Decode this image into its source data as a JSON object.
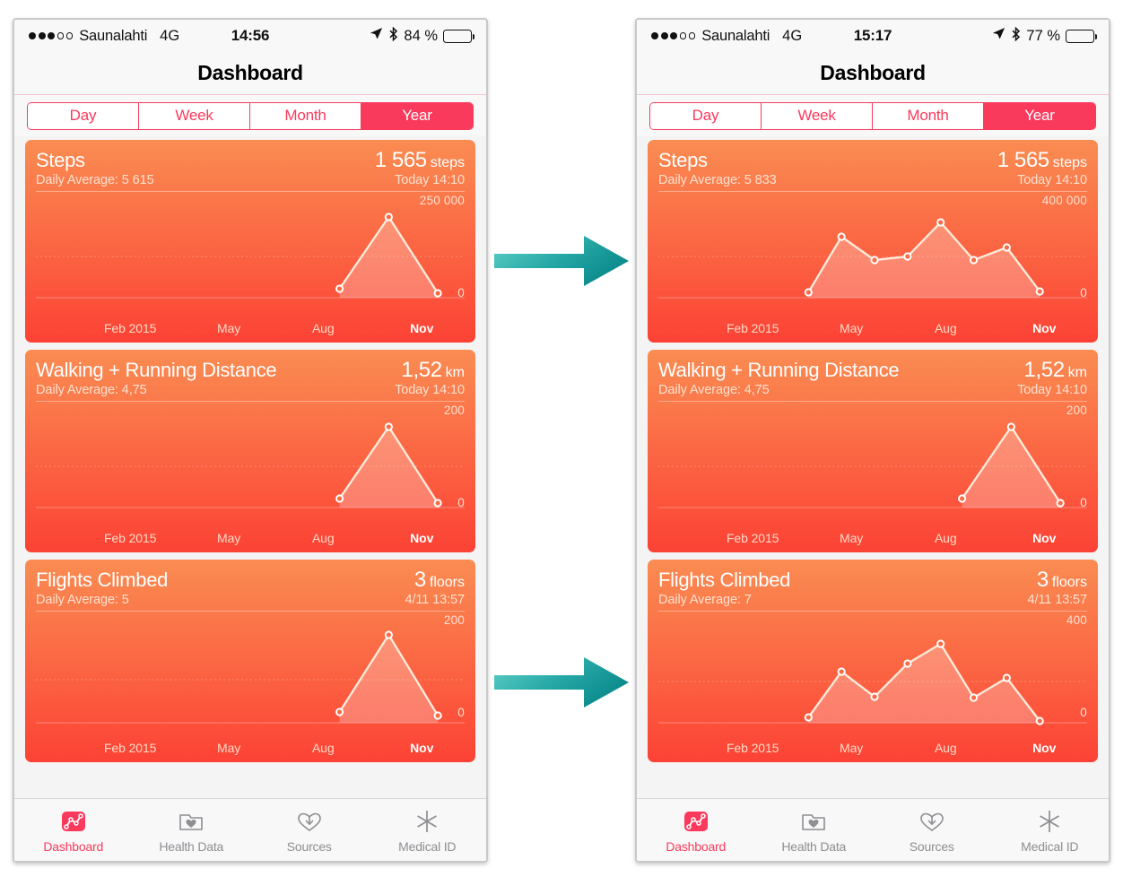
{
  "accent": {
    "pink": "#fa3a5c",
    "card_top": "#fa8c52",
    "card_bottom": "#fc4235",
    "arrow_teal_light": "#5fd0c8",
    "arrow_teal_dark": "#0e8f8f",
    "tab_inactive": "#8e8e93"
  },
  "left_phone": {
    "status": {
      "carrier": "Saunalahti",
      "network": "4G",
      "time": "14:56",
      "battery_percent": "84 %",
      "signal_dots_filled": 3,
      "signal_dots_total": 5,
      "location_icon": "location-arrow-icon",
      "bluetooth_icon": "bluetooth-icon"
    },
    "nav": {
      "title": "Dashboard"
    },
    "segmented": {
      "options": [
        "Day",
        "Week",
        "Month",
        "Year"
      ],
      "selected": "Year"
    },
    "cards": [
      {
        "title": "Steps",
        "value": "1 565",
        "unit": "steps",
        "average": "Daily Average: 5 615",
        "when": "Today 14:10",
        "y_max": "250 000",
        "y_min": "0"
      },
      {
        "title": "Walking + Running Distance",
        "value": "1,52",
        "unit": "km",
        "average": "Daily Average: 4,75",
        "when": "Today 14:10",
        "y_max": "200",
        "y_min": "0"
      },
      {
        "title": "Flights Climbed",
        "value": "3",
        "unit": "floors",
        "average": "Daily Average: 5",
        "when": "4/11 13:57",
        "y_max": "200",
        "y_min": "0"
      }
    ],
    "tabs": [
      {
        "label": "Dashboard",
        "icon": "dashboard-chart-icon",
        "active": true
      },
      {
        "label": "Health Data",
        "icon": "folder-heart-icon",
        "active": false
      },
      {
        "label": "Sources",
        "icon": "heart-download-icon",
        "active": false
      },
      {
        "label": "Medical ID",
        "icon": "medical-asterisk-icon",
        "active": false
      }
    ]
  },
  "right_phone": {
    "status": {
      "carrier": "Saunalahti",
      "network": "4G",
      "time": "15:17",
      "battery_percent": "77 %",
      "signal_dots_filled": 3,
      "signal_dots_total": 5,
      "location_icon": "location-arrow-icon",
      "bluetooth_icon": "bluetooth-icon"
    },
    "nav": {
      "title": "Dashboard"
    },
    "segmented": {
      "options": [
        "Day",
        "Week",
        "Month",
        "Year"
      ],
      "selected": "Year"
    },
    "cards": [
      {
        "title": "Steps",
        "value": "1 565",
        "unit": "steps",
        "average": "Daily Average: 5 833",
        "when": "Today 14:10",
        "y_max": "400 000",
        "y_min": "0"
      },
      {
        "title": "Walking + Running Distance",
        "value": "1,52",
        "unit": "km",
        "average": "Daily Average: 4,75",
        "when": "Today 14:10",
        "y_max": "200",
        "y_min": "0"
      },
      {
        "title": "Flights Climbed",
        "value": "3",
        "unit": "floors",
        "average": "Daily Average: 7",
        "when": "4/11 13:57",
        "y_max": "400",
        "y_min": "0"
      }
    ],
    "tabs": [
      {
        "label": "Dashboard",
        "icon": "dashboard-chart-icon",
        "active": true
      },
      {
        "label": "Health Data",
        "icon": "folder-heart-icon",
        "active": false
      },
      {
        "label": "Sources",
        "icon": "heart-download-icon",
        "active": false
      },
      {
        "label": "Medical ID",
        "icon": "medical-asterisk-icon",
        "active": false
      }
    ]
  },
  "x_axis_labels": [
    "Feb 2015",
    "May",
    "Aug",
    "Nov"
  ],
  "chart_data": [
    {
      "id": "left-steps",
      "type": "line",
      "title": "Steps",
      "xlabel": "",
      "ylabel": "steps",
      "ylim": [
        0,
        250000
      ],
      "grid": true,
      "tick_labels": [
        "Feb 2015",
        "May",
        "Aug",
        "Nov"
      ],
      "x": [
        "Sep",
        "Oct",
        "Nov"
      ],
      "values": [
        42000,
        210000,
        32000
      ]
    },
    {
      "id": "left-walking",
      "type": "line",
      "title": "Walking + Running Distance",
      "xlabel": "",
      "ylabel": "km",
      "ylim": [
        0,
        200
      ],
      "grid": true,
      "tick_labels": [
        "Feb 2015",
        "May",
        "Aug",
        "Nov"
      ],
      "x": [
        "Sep",
        "Oct",
        "Nov"
      ],
      "values": [
        34,
        168,
        28
      ]
    },
    {
      "id": "left-flights",
      "type": "line",
      "title": "Flights Climbed",
      "xlabel": "",
      "ylabel": "floors",
      "ylim": [
        0,
        200
      ],
      "grid": true,
      "tick_labels": [
        "Feb 2015",
        "May",
        "Aug",
        "Nov"
      ],
      "x": [
        "Sep",
        "Oct",
        "Nov"
      ],
      "values": [
        34,
        168,
        28
      ]
    },
    {
      "id": "right-steps",
      "type": "line",
      "title": "Steps",
      "xlabel": "",
      "ylabel": "steps",
      "ylim": [
        0,
        400000
      ],
      "grid": true,
      "tick_labels": [
        "Feb 2015",
        "May",
        "Aug",
        "Nov"
      ],
      "x": [
        "Apr",
        "May",
        "Jun",
        "Jul",
        "Aug",
        "Sep",
        "Oct",
        "Nov"
      ],
      "values": [
        24000,
        258000,
        170000,
        180000,
        300000,
        172000,
        208000,
        36000
      ]
    },
    {
      "id": "right-walking",
      "type": "line",
      "title": "Walking + Running Distance",
      "xlabel": "",
      "ylabel": "km",
      "ylim": [
        0,
        200
      ],
      "grid": true,
      "tick_labels": [
        "Feb 2015",
        "May",
        "Aug",
        "Nov"
      ],
      "x": [
        "Sep",
        "Oct",
        "Nov"
      ],
      "values": [
        34,
        168,
        28
      ]
    },
    {
      "id": "right-flights",
      "type": "line",
      "title": "Flights Climbed",
      "xlabel": "",
      "ylabel": "floors",
      "ylim": [
        0,
        400
      ],
      "grid": true,
      "tick_labels": [
        "Feb 2015",
        "May",
        "Aug",
        "Nov"
      ],
      "x": [
        "Apr",
        "May",
        "Jun",
        "Jul",
        "Aug",
        "Sep",
        "Oct",
        "Nov"
      ],
      "values": [
        24,
        228,
        140,
        250,
        310,
        130,
        208,
        14
      ]
    }
  ],
  "arrows": [
    {
      "name": "arrow-steps",
      "direction": "right"
    },
    {
      "name": "arrow-flights",
      "direction": "right"
    }
  ]
}
